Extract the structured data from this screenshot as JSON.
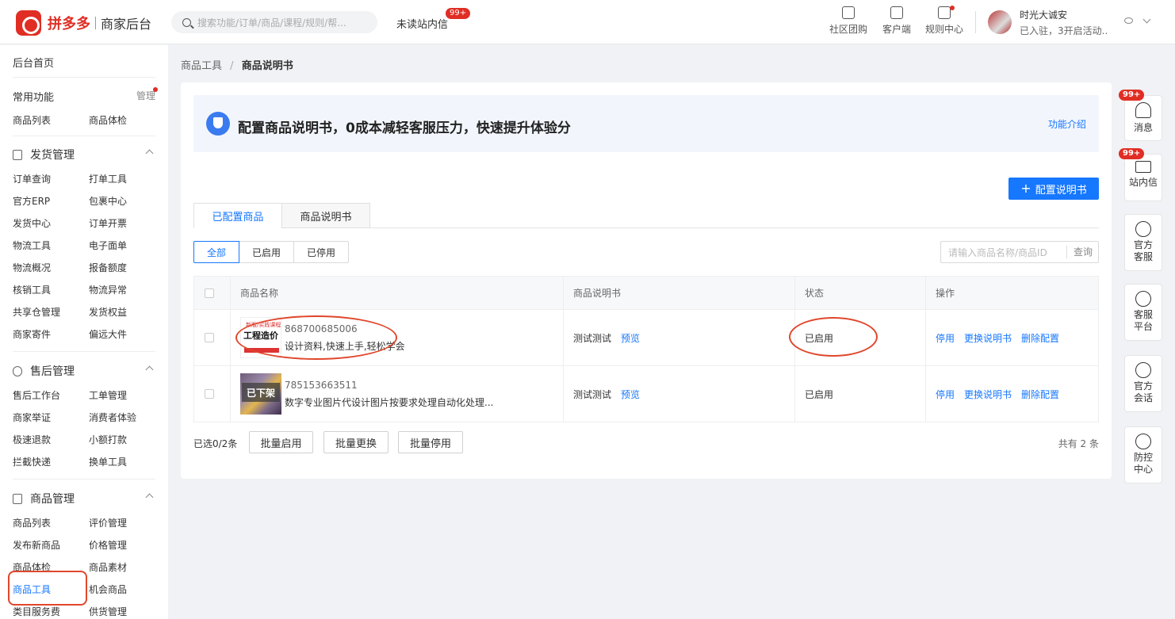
{
  "brand": {
    "name": "拼多多",
    "subtitle": "商家后台",
    "color": "#e02e24"
  },
  "header": {
    "search_placeholder": "搜索功能/订单/商品/课程/规则/帮...",
    "unread_label": "未读站内信",
    "unread_badge": "99+",
    "buttons": [
      {
        "label": "社区团购",
        "icon": "store-icon"
      },
      {
        "label": "客户端",
        "icon": "desktop-icon"
      },
      {
        "label": "规则中心",
        "icon": "document-icon"
      }
    ],
    "shop_name": "时光大诚安",
    "shop_sub": "已入驻，3开启活动..."
  },
  "sidebar": {
    "home": "后台首页",
    "common_title": "常用功能",
    "common_manage": "管理",
    "common_items": [
      "商品列表",
      "商品体检"
    ],
    "sections": [
      {
        "title": "发货管理",
        "items": [
          "订单查询",
          "打单工具",
          "官方ERP",
          "包裹中心",
          "发货中心",
          "订单开票",
          "物流工具",
          "电子面单",
          "物流概况",
          "报备额度",
          "核销工具",
          "物流异常",
          "共享仓管理",
          "发货权益",
          "商家寄件",
          "偏远大件"
        ]
      },
      {
        "title": "售后管理",
        "items": [
          "售后工作台",
          "工单管理",
          "商家举证",
          "消费者体验",
          "极速退款",
          "小额打款",
          "拦截快递",
          "换单工具"
        ]
      },
      {
        "title": "商品管理",
        "items": [
          "商品列表",
          "评价管理",
          "发布新商品",
          "价格管理",
          "商品体检",
          "商品素材",
          "商品工具",
          "机会商品",
          "类目服务费",
          "供货管理"
        ]
      }
    ],
    "active_item": "商品工具"
  },
  "breadcrumb": {
    "parent": "商品工具",
    "separator": "/",
    "current": "商品说明书"
  },
  "banner": {
    "title": "配置商品说明书，0成本减轻客服压力，快速提升体验分",
    "link": "功能介绍"
  },
  "config_button": "配置说明书",
  "tabs": [
    "已配置商品",
    "商品说明书"
  ],
  "filters": [
    "全部",
    "已启用",
    "已停用"
  ],
  "query": {
    "placeholder": "请输入商品名称/商品ID",
    "button": "查询"
  },
  "table": {
    "columns": [
      "商品名称",
      "商品说明书",
      "状态",
      "操作"
    ],
    "rows": [
      {
        "id": "868700685006",
        "name": "设计资料,快速上手,轻松学会",
        "thumb_text": "工程造价",
        "thumb_top": "新版/实践课程",
        "manual": "测试测试",
        "preview": "预览",
        "status": "已启用",
        "actions": [
          "停用",
          "更换说明书",
          "删除配置"
        ]
      },
      {
        "id": "785153663511",
        "name": "数字专业图片代设计图片按要求处理自动化处理...",
        "thumb_text": "已下架",
        "manual": "测试测试",
        "preview": "预览",
        "status": "已启用",
        "actions": [
          "停用",
          "更换说明书",
          "删除配置"
        ]
      }
    ]
  },
  "footer": {
    "selected": "已选0/2条",
    "buttons": [
      "批量启用",
      "批量更换",
      "批量停用"
    ],
    "total": "共有 2 条"
  },
  "float_bar": [
    {
      "label": "消息",
      "badge": "99+",
      "icon": "bell-icon"
    },
    {
      "label": "站内信",
      "badge": "99+",
      "icon": "mail-icon"
    },
    {
      "label": "官方客服",
      "icon": "agent-icon"
    },
    {
      "label": "客服平台",
      "icon": "chat-icon"
    },
    {
      "label": "官方会话",
      "icon": "users-icon"
    },
    {
      "label": "防控中心",
      "icon": "alert-icon"
    }
  ],
  "accent_color": "#1677ff"
}
